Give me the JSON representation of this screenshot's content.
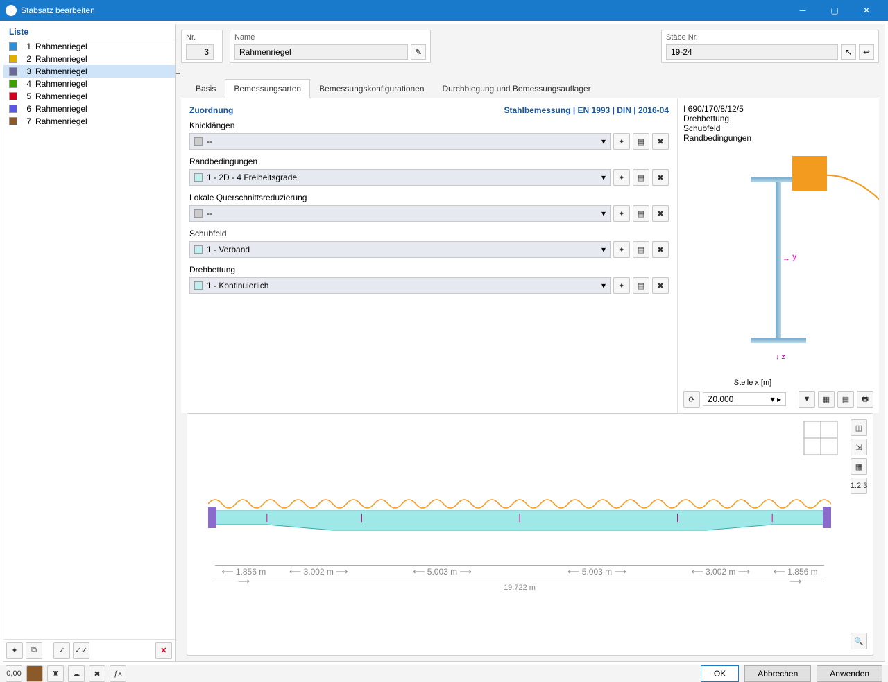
{
  "window": {
    "title": "Stabsatz bearbeiten"
  },
  "list": {
    "heading": "Liste",
    "items": [
      {
        "num": "1",
        "label": "Rahmenriegel",
        "color": "#2b8fd8"
      },
      {
        "num": "2",
        "label": "Rahmenriegel",
        "color": "#e0b000"
      },
      {
        "num": "3",
        "label": "Rahmenriegel",
        "color": "#6a6a9a",
        "selected": true
      },
      {
        "num": "4",
        "label": "Rahmenriegel",
        "color": "#3aa000"
      },
      {
        "num": "5",
        "label": "Rahmenriegel",
        "color": "#d00020"
      },
      {
        "num": "6",
        "label": "Rahmenriegel",
        "color": "#5a5ae0"
      },
      {
        "num": "7",
        "label": "Rahmenriegel",
        "color": "#8a5a2a"
      }
    ]
  },
  "fields": {
    "nr_label": "Nr.",
    "nr_value": "3",
    "name_label": "Name",
    "name_value": "Rahmenriegel",
    "stabe_label": "Stäbe Nr.",
    "stabe_value": "19-24"
  },
  "tabs": {
    "items": [
      "Basis",
      "Bemessungsarten",
      "Bemessungskonfigurationen",
      "Durchbiegung und Bemessungsauflager"
    ],
    "active": 1
  },
  "section": {
    "title": "Zuordnung",
    "spec": "Stahlbemessung | EN 1993 | DIN | 2016-04"
  },
  "rows": [
    {
      "label": "Knicklängen",
      "value": "--",
      "gray": true
    },
    {
      "label": "Randbedingungen",
      "value": "1 - 2D - 4 Freiheitsgrade"
    },
    {
      "label": "Lokale Querschnittsreduzierung",
      "value": "--",
      "gray": true
    },
    {
      "label": "Schubfeld",
      "value": "1 - Verband"
    },
    {
      "label": "Drehbettung",
      "value": "1 - Kontinuierlich"
    }
  ],
  "preview": {
    "lines": [
      "I 690/170/8/12/5",
      "Drehbettung",
      "Schubfeld",
      "Randbedingungen"
    ],
    "stelle_label": "Stelle x [m]",
    "stelle_value": "Z0.000"
  },
  "beam": {
    "dims": [
      "1.856 m",
      "3.002 m",
      "5.003 m",
      "5.003 m",
      "3.002 m",
      "1.856 m"
    ],
    "total": "19.722 m"
  },
  "footer": {
    "ok": "OK",
    "cancel": "Abbrechen",
    "apply": "Anwenden"
  }
}
